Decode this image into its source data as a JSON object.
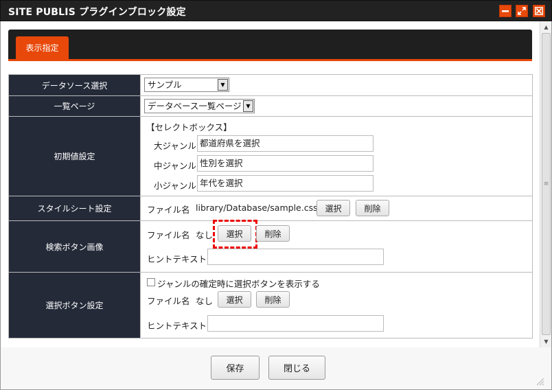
{
  "window": {
    "title": "SITE PUBLIS プラグインブロック設定",
    "controls": [
      "minimize-icon",
      "maximize-icon",
      "close-icon"
    ]
  },
  "tabs": [
    {
      "label": "表示指定",
      "active": true
    }
  ],
  "form": {
    "datasource": {
      "label": "データソース選択",
      "selected": "サンプル"
    },
    "list_page": {
      "label": "一覧ページ",
      "selected": "データベース一覧ページ"
    },
    "initial": {
      "label": "初期値設定",
      "heading": "【セレクトボックス】",
      "fields": [
        {
          "label": "大ジャンル",
          "value": "都道府県を選択"
        },
        {
          "label": "中ジャンル",
          "value": "性別を選択"
        },
        {
          "label": "小ジャンル",
          "value": "年代を選択"
        }
      ]
    },
    "stylesheet": {
      "label": "スタイルシート設定",
      "file_label": "ファイル名",
      "file_value": "library/Database/sample.css",
      "select_label": "選択",
      "delete_label": "削除"
    },
    "search_image": {
      "label": "検索ボタン画像",
      "file_label": "ファイル名",
      "file_value": "なし",
      "select_label": "選択",
      "delete_label": "削除",
      "hint_label": "ヒントテキスト",
      "hint_value": ""
    },
    "select_button": {
      "label": "選択ボタン設定",
      "checkbox_label": "ジャンルの確定時に選択ボタンを表示する",
      "checkbox_checked": false,
      "file_label": "ファイル名",
      "file_value": "なし",
      "select_label": "選択",
      "delete_label": "削除",
      "hint_label": "ヒントテキスト",
      "hint_value": ""
    }
  },
  "footer": {
    "save_label": "保存",
    "close_label": "閉じる"
  },
  "colors": {
    "accent": "#e8480a",
    "label_bg": "#242a38",
    "highlight": "#ee0000"
  }
}
